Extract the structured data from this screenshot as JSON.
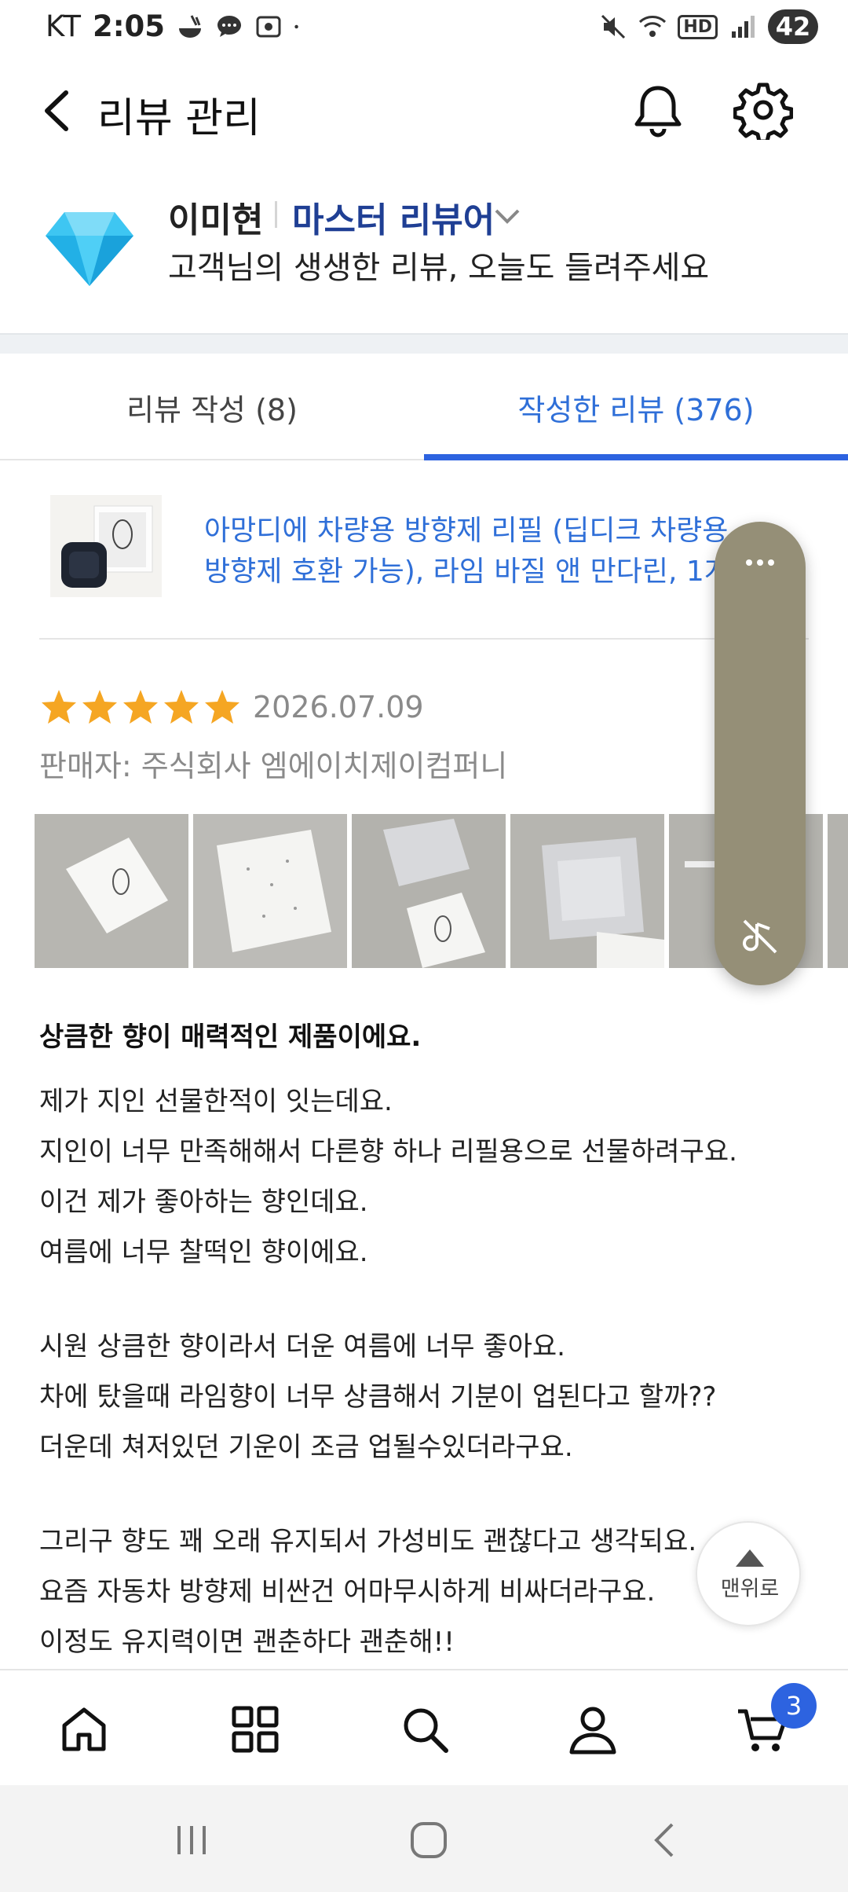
{
  "status": {
    "carrier": "KT",
    "time": "2:05",
    "battery": "42",
    "hd_label": "HD"
  },
  "header": {
    "title": "리뷰 관리"
  },
  "profile": {
    "name": "이미현",
    "grade": "마스터 리뷰어",
    "subtitle": "고객님의 생생한 리뷰, 오늘도 들려주세요"
  },
  "tabs": [
    {
      "label": "리뷰 작성 (8)",
      "active": false
    },
    {
      "label": "작성한 리뷰 (376)",
      "active": true
    }
  ],
  "product": {
    "title_line1": "아망디에 차량용 방향제 리필 (딥디크 차량용",
    "title_line2": "방향제 호환 가능), 라임 바질 앤 만다린, 1개"
  },
  "review": {
    "rating": 5,
    "rating_max": 5,
    "date": "2026.07.09",
    "seller": "판매자: 주식회사 엠에이치제이컴퍼니",
    "photo_count": 6,
    "headline": "상큼한 향이 매력적인 제품이에요.",
    "body_lines": [
      "제가 지인 선물한적이 잇는데요.",
      "지인이 너무 만족해해서 다른향 하나 리필용으로 선물하려구요.",
      "이건 제가 좋아하는 향인데요.",
      "여름에 너무 찰떡인 향이에요.",
      "",
      "시원 상큼한 향이라서 더운 여름에 너무 좋아요.",
      "차에 탔을때 라임향이 너무 상큼해서 기분이 업된다고 할까??",
      "더운데 쳐저있던 기운이 조금 업될수있더라구요.",
      "",
      "그리구 향도 꽤 오래 유지되서 가성비도 괜찮다고 생각되요.",
      "요즘 자동차 방향제 비싼건 어마무시하게 비싸더라구요.",
      "이정도 유지력이면 괜춘하다 괜춘해!!"
    ]
  },
  "to_top": {
    "label": "맨위로"
  },
  "bottom_nav": {
    "items": [
      "home-icon",
      "categories-icon",
      "search-icon",
      "my-account-icon",
      "cart-icon"
    ],
    "cart_badge": "3"
  },
  "colors": {
    "accent_blue": "#2d63e0",
    "link_blue": "#2f6fd8",
    "grade_navy": "#1f3f94",
    "star_yellow": "#f5a623",
    "float_panel": "#958f77"
  }
}
